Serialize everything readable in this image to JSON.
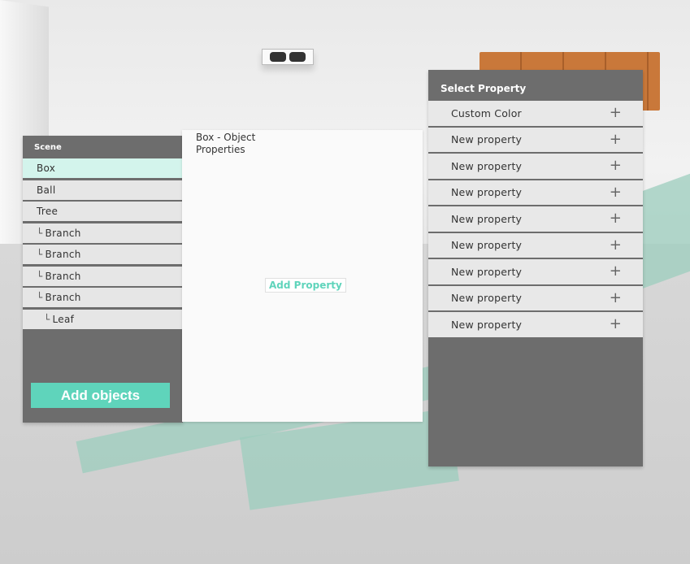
{
  "scene": {
    "title": "Scene",
    "items": [
      {
        "label": "Box",
        "indent": "",
        "selected": true
      },
      {
        "label": "Ball",
        "indent": "",
        "selected": false
      },
      {
        "label": "Tree",
        "indent": "",
        "selected": false
      },
      {
        "label": "Branch",
        "indent": "└",
        "selected": false
      },
      {
        "label": "Branch",
        "indent": "└",
        "selected": false
      },
      {
        "label": "Branch",
        "indent": "└",
        "selected": false
      },
      {
        "label": "Branch",
        "indent": "└",
        "selected": false
      },
      {
        "label": "Leaf",
        "indent": "└",
        "selected": false
      }
    ],
    "add_button": "Add objects"
  },
  "properties": {
    "title": "Box - Object Properties",
    "add_button": "Add Property"
  },
  "select_property": {
    "title": "Select Property",
    "items": [
      {
        "label": "Custom Color",
        "icon": "plus-icon"
      },
      {
        "label": "New property",
        "icon": "plus-icon"
      },
      {
        "label": "New property",
        "icon": "plus-icon"
      },
      {
        "label": "New property",
        "icon": "plus-icon"
      },
      {
        "label": "New property",
        "icon": "plus-icon"
      },
      {
        "label": "New property",
        "icon": "plus-icon"
      },
      {
        "label": "New property",
        "icon": "plus-icon"
      },
      {
        "label": "New property",
        "icon": "plus-icon"
      },
      {
        "label": "New property",
        "icon": "plus-icon"
      }
    ]
  },
  "colors": {
    "accent": "#5fd4bb",
    "selected": "#d3f4ec",
    "panel": "#6d6d6d",
    "shelf": "#c9783a"
  }
}
